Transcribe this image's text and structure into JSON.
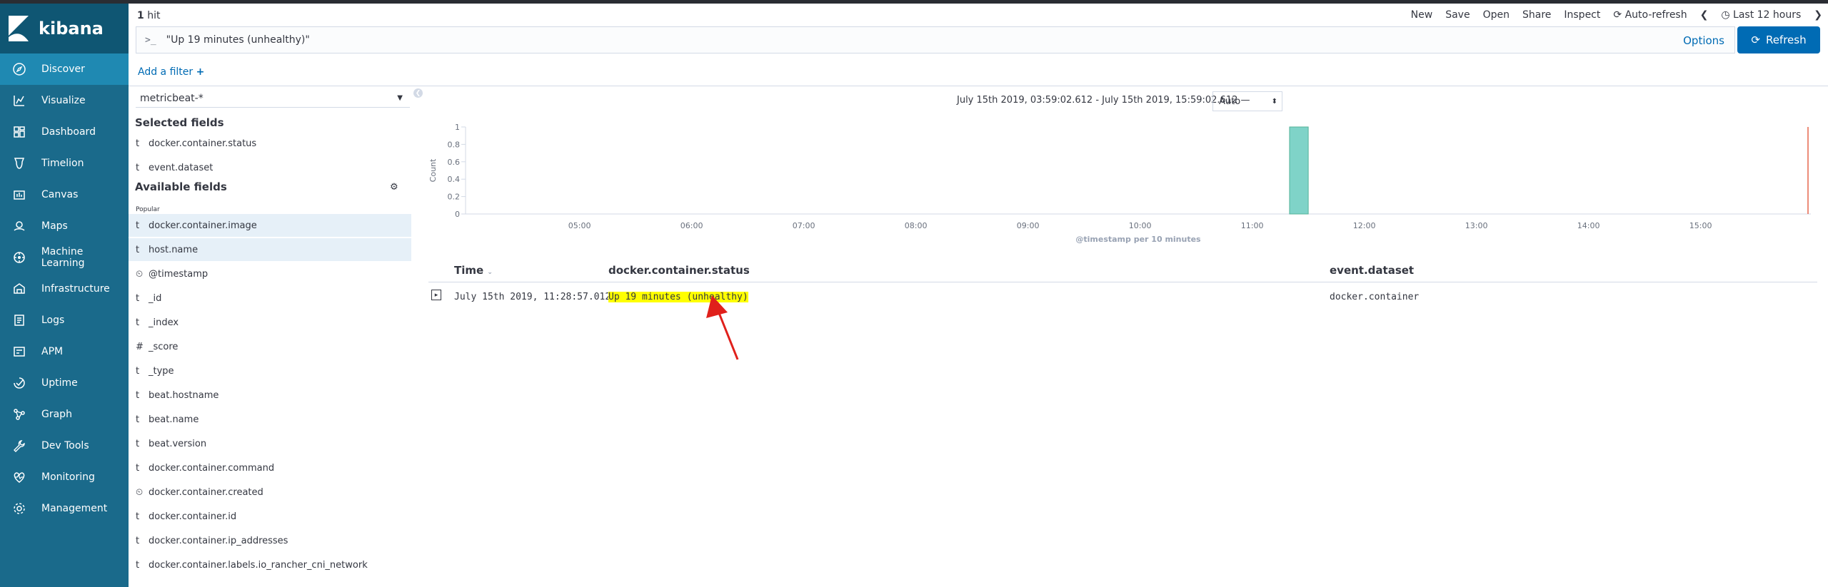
{
  "app": {
    "name": "kibana"
  },
  "topbar": {
    "hit_count": "1",
    "hit_label": "hit",
    "menu": {
      "new": "New",
      "save": "Save",
      "open": "Open",
      "share": "Share",
      "inspect": "Inspect",
      "auto_refresh": "Auto-refresh",
      "time": "Last 12 hours"
    }
  },
  "query": {
    "prompt": ">_",
    "value": "\"Up 19 minutes (unhealthy)\"",
    "options": "Options",
    "refresh": "Refresh"
  },
  "filter": {
    "add": "Add a filter"
  },
  "sidebar": {
    "items": [
      {
        "label": "Discover",
        "icon": "compass-icon"
      },
      {
        "label": "Visualize",
        "icon": "chart-icon"
      },
      {
        "label": "Dashboard",
        "icon": "dashboard-icon"
      },
      {
        "label": "Timelion",
        "icon": "timelion-icon"
      },
      {
        "label": "Canvas",
        "icon": "canvas-icon"
      },
      {
        "label": "Maps",
        "icon": "map-icon"
      },
      {
        "label": "Machine Learning",
        "icon": "ml-icon"
      },
      {
        "label": "Infrastructure",
        "icon": "infrastructure-icon"
      },
      {
        "label": "Logs",
        "icon": "logs-icon"
      },
      {
        "label": "APM",
        "icon": "apm-icon"
      },
      {
        "label": "Uptime",
        "icon": "uptime-icon"
      },
      {
        "label": "Graph",
        "icon": "graph-icon"
      },
      {
        "label": "Dev Tools",
        "icon": "wrench-icon"
      },
      {
        "label": "Monitoring",
        "icon": "heartbeat-icon"
      },
      {
        "label": "Management",
        "icon": "gear-icon"
      }
    ]
  },
  "fields": {
    "index_pattern": "metricbeat-*",
    "selected_title": "Selected fields",
    "selected": [
      {
        "type": "t",
        "name": "docker.container.status"
      },
      {
        "type": "t",
        "name": "event.dataset"
      }
    ],
    "available_title": "Available fields",
    "popular_label": "Popular",
    "available": [
      {
        "type": "t",
        "name": "docker.container.image"
      },
      {
        "type": "t",
        "name": "host.name"
      },
      {
        "type": "⏲",
        "name": "@timestamp"
      },
      {
        "type": "t",
        "name": "_id"
      },
      {
        "type": "t",
        "name": "_index"
      },
      {
        "type": "#",
        "name": "_score"
      },
      {
        "type": "t",
        "name": "_type"
      },
      {
        "type": "t",
        "name": "beat.hostname"
      },
      {
        "type": "t",
        "name": "beat.name"
      },
      {
        "type": "t",
        "name": "beat.version"
      },
      {
        "type": "t",
        "name": "docker.container.command"
      },
      {
        "type": "⏲",
        "name": "docker.container.created"
      },
      {
        "type": "t",
        "name": "docker.container.id"
      },
      {
        "type": "t",
        "name": "docker.container.ip_addresses"
      },
      {
        "type": "t",
        "name": "docker.container.labels.io_rancher_cni_network"
      }
    ]
  },
  "histogram": {
    "time_range": "July 15th 2019, 03:59:02.612 - July 15th 2019, 15:59:02.612 —",
    "interval": "Auto"
  },
  "chart_data": {
    "type": "bar",
    "ylabel": "Count",
    "xlabel": "@timestamp per 10 minutes",
    "ylim": [
      0,
      1
    ],
    "yticks": [
      "1",
      "0.8",
      "0.6",
      "0.4",
      "0.2",
      "0"
    ],
    "xticks": [
      "05:00",
      "06:00",
      "07:00",
      "08:00",
      "09:00",
      "10:00",
      "11:00",
      "12:00",
      "13:00",
      "14:00",
      "15:00"
    ],
    "bars": [
      {
        "x": "11:20",
        "value": 1
      }
    ],
    "bar_color": "#7fd3c8",
    "now_marker_color": "#e7664c"
  },
  "table": {
    "columns": [
      "Time",
      "docker.container.status",
      "event.dataset"
    ],
    "rows": [
      {
        "time": "July 15th 2019, 11:28:57.012",
        "status": "Up 19 minutes (unhealthy)",
        "dataset": "docker.container"
      }
    ]
  }
}
